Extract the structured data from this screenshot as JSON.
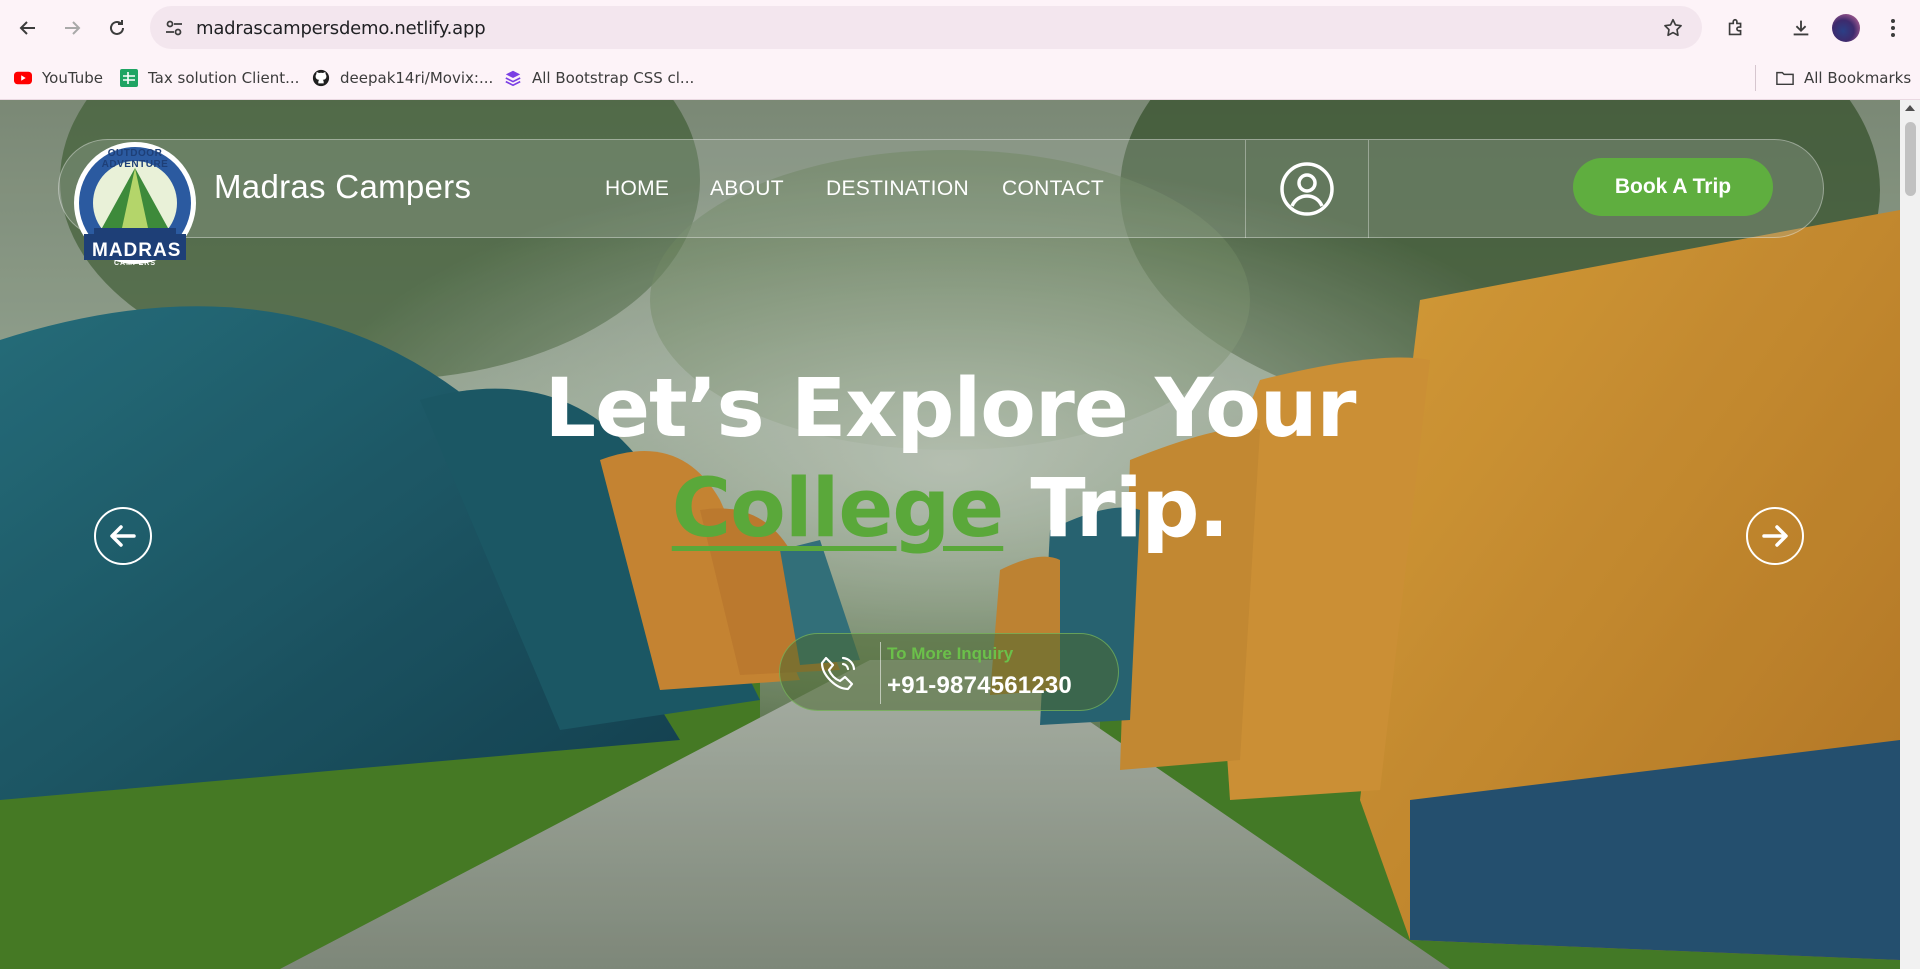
{
  "browser": {
    "url": "madrascampersdemo.netlify.app",
    "bookmarks": [
      {
        "label": "YouTube",
        "icon": "youtube-icon"
      },
      {
        "label": "Tax solution Client...",
        "icon": "sheets-icon"
      },
      {
        "label": "deepak14ri/Movix:...",
        "icon": "github-icon"
      },
      {
        "label": "All Bootstrap CSS cl...",
        "icon": "layers-icon"
      }
    ],
    "all_bookmarks": "All Bookmarks"
  },
  "site": {
    "logo_text": {
      "arc": "OUTDOOR ADVENTURE",
      "main": "MADRAS",
      "sub": "CAMPERS"
    },
    "brand": "Madras Campers",
    "menu": [
      "HOME",
      "ABOUT",
      "DESTINATION",
      "CONTACT"
    ],
    "book_button": "Book A Trip"
  },
  "hero": {
    "line1": "Let’s Explore Your",
    "highlight": "College",
    "line2_rest": " Trip.",
    "inquiry_label": "To More Inquiry",
    "inquiry_number": "+91-9874561230"
  },
  "colors": {
    "accent": "#5fae3f",
    "highlight": "#5aa83a"
  }
}
